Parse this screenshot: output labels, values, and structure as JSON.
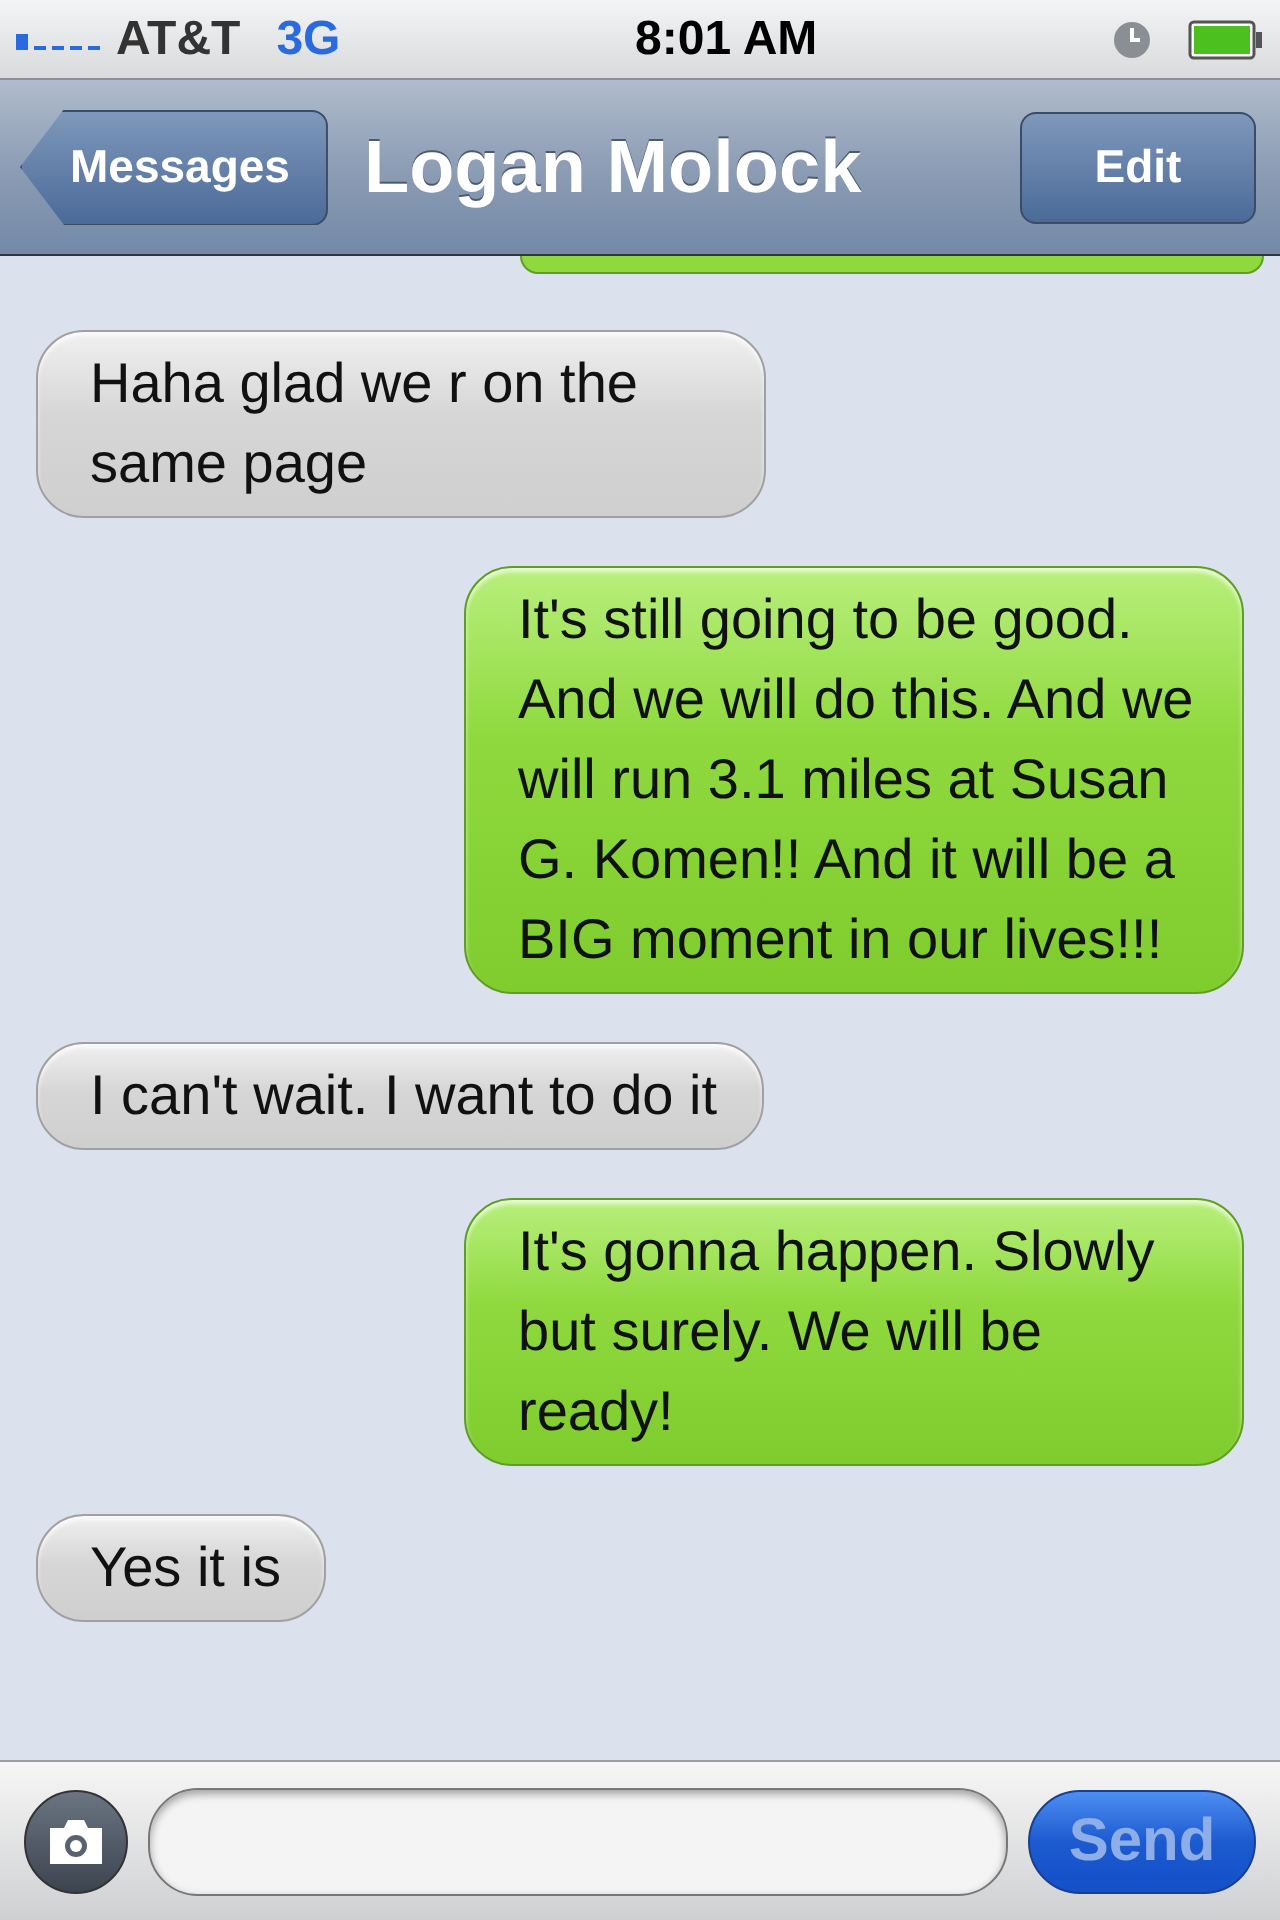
{
  "status_bar": {
    "carrier": "AT&T",
    "network": "3G",
    "time": "8:01 AM"
  },
  "nav_bar": {
    "back": "Messages",
    "title": "Logan Molock",
    "action": "Edit"
  },
  "messages": [
    {
      "kind": "sent-partial"
    },
    {
      "kind": "received",
      "text": "Haha glad we r on the same page"
    },
    {
      "kind": "sent",
      "text": "It's still going to be good. And we will do this. And we will run 3.1 miles at Susan G. Komen!! And it will be a BIG moment in our lives!!!"
    },
    {
      "kind": "received",
      "text": "I can't wait. I want to do it"
    },
    {
      "kind": "sent",
      "text": "It's gonna happen. Slowly but surely. We will be ready!"
    },
    {
      "kind": "received",
      "text": "Yes it is"
    }
  ],
  "composer": {
    "send": "Send",
    "send_disabled": true
  }
}
